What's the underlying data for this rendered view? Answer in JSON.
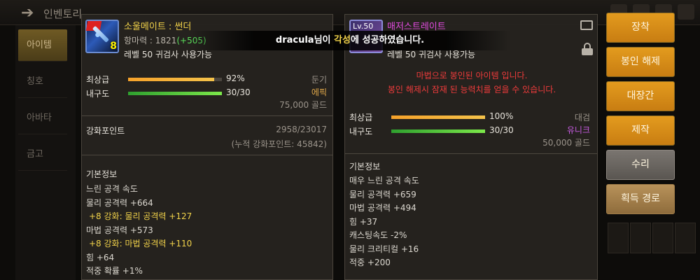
{
  "background": {
    "title": "인벤토리",
    "side_tabs": [
      "아이템",
      "칭호",
      "아바타",
      "금고"
    ]
  },
  "system_message": {
    "user": "dracula",
    "pre": "님이 ",
    "highlight": "각성",
    "post": "에 성공하였습니다."
  },
  "left_item": {
    "icon_badge": "8",
    "name": "소울메이트 : 썬더",
    "power_label": "항마력 : 1821",
    "power_bonus": "(+505)",
    "level_req": "레벨 50 귀검사 사용가능",
    "grade": {
      "label": "최상급",
      "percent": 92,
      "value": "92%"
    },
    "durability": {
      "label": "내구도",
      "percent": 100,
      "value": "30/30"
    },
    "weapon_type": "둔기",
    "rarity": "에픽",
    "price": "75,000 골드",
    "reinforce_label": "강화포인트",
    "reinforce_value": "2958/23017",
    "reinforce_total": "(누적 강화포인트: 45842)",
    "section_title": "기본정보",
    "stats": [
      {
        "text": "느린 공격 속도",
        "enh": false
      },
      {
        "text": "물리 공격력 +664",
        "enh": false
      },
      {
        "text": "+8 강화: 물리 공격력 +127",
        "enh": true
      },
      {
        "text": "마법 공격력 +573",
        "enh": false
      },
      {
        "text": "+8 강화: 마법 공격력 +110",
        "enh": true
      },
      {
        "text": "힘 +64",
        "enh": false
      },
      {
        "text": "적중 확률 +1%",
        "enh": false
      }
    ]
  },
  "right_item": {
    "level_badge": "Lv.50",
    "name": "매저스트레이트",
    "level_req": "레벨 50 귀검사 사용가능",
    "sealed_line1": "마법으로 봉인된 아이템 입니다.",
    "sealed_line2": "봉인 해제시 잠재 된 능력치를 얻을 수 있습니다.",
    "grade": {
      "label": "최상급",
      "percent": 100,
      "value": "100%"
    },
    "durability": {
      "label": "내구도",
      "percent": 100,
      "value": "30/30"
    },
    "weapon_type": "대검",
    "rarity": "유니크",
    "price": "50,000 골드",
    "section_title": "기본정보",
    "stats": [
      "매우 느린 공격 속도",
      "물리 공격력 +659",
      "마법 공격력 +494",
      "힘 +37",
      "캐스팅속도 -2%",
      "물리 크리티컬 +16",
      "적중 +200"
    ]
  },
  "actions": {
    "equip": "장착",
    "unseal": "봉인 해제",
    "blacksmith": "대장간",
    "craft": "제작",
    "repair": "수리",
    "acquire_path": "획득 경로"
  }
}
